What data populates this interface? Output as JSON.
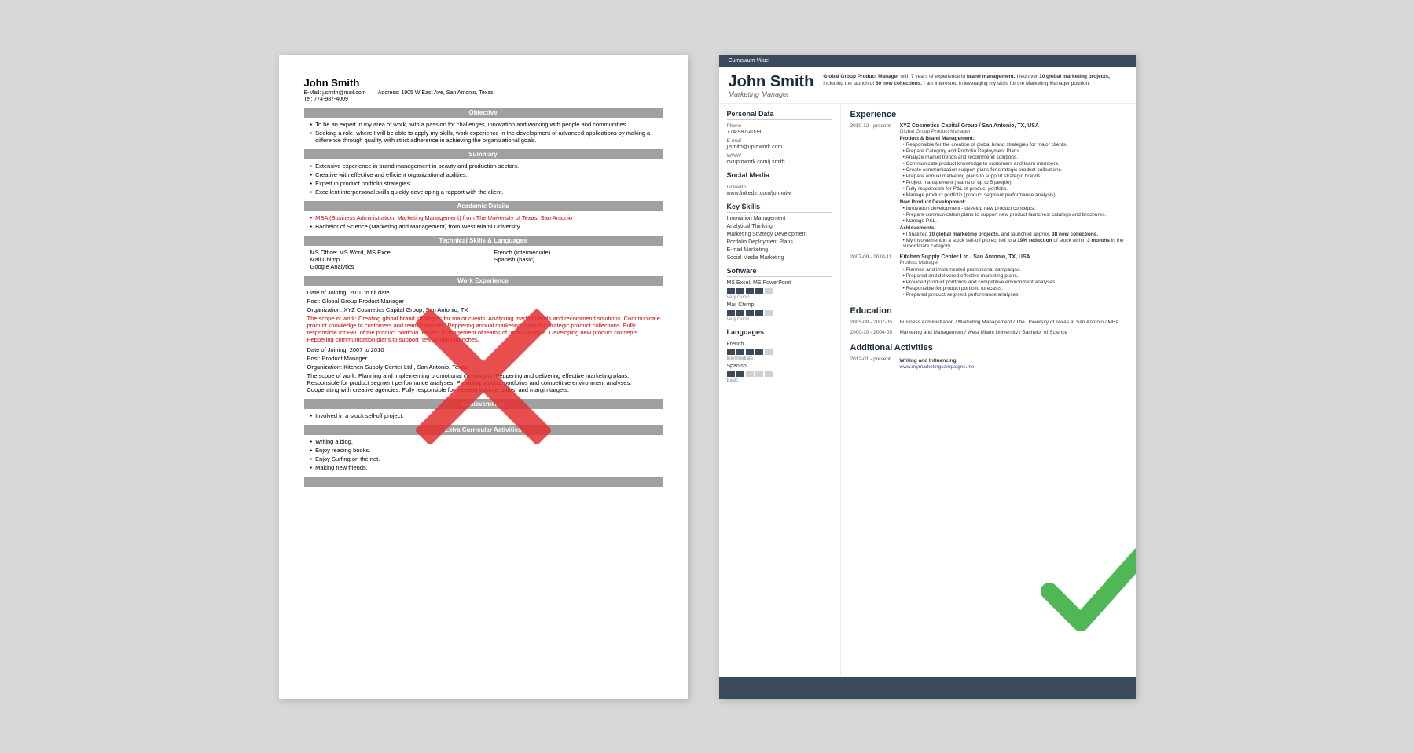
{
  "left_resume": {
    "name": "John Smith",
    "email_label": "E-Mail:",
    "email": "j.smith@mail.com",
    "address_label": "Address:",
    "address": "1905 W East Ave, San Antonio, Texas",
    "tel_label": "Tel:",
    "tel": "774-987-4009",
    "sections": {
      "objective": {
        "title": "Objective",
        "bullets": [
          "To be an expert in my area of work, with a passion for challenges, innovation and working with people and communities.",
          "Seeking a role, where I will be able to apply my skills, work experience in the development of advanced applications by making a difference through quality, with strict adherence in achieving the organizational goals."
        ]
      },
      "summary": {
        "title": "Summary",
        "bullets": [
          "Extensive experience in brand management in beauty and production sectors.",
          "Creative with effective and efficient organizational abilities.",
          "Expert in product portfolio strategies.",
          "Excellent interpersonal skills quickly developing a rapport with the client."
        ]
      },
      "academic": {
        "title": "Academic Details",
        "bullets": [
          "MBA (Business Administration, Marketing Management) from The University of Texas, San Antonio",
          "Bachelor of Science (Marketing and Management) from West Miami University"
        ]
      },
      "technical": {
        "title": "Technical Skills & Languages",
        "left_col": [
          "MS Office: MS Word, MS Excel",
          "Mail Chimp",
          "Google Analytics"
        ],
        "right_col": [
          "French (intermediate)",
          "Spanish (basic)"
        ]
      },
      "work_experience": {
        "title": "Work Experience",
        "entries": [
          {
            "date_joining": "Date of Joining: 2010 to till date",
            "post": "Post: Global Group Product Manager",
            "org": "Organization: XYZ Cosmetics Capital Group, San Antonio, TX",
            "scope": "The scope of work: Creating global brand strategies for major clients. Analyzing market trends and recommend solutions. Communicate product knowledge to customers and team members. Peppering annual marketing plans for strategic product collections. Fully responsible for P&L of the product portfolio. Project management of teams of up to 5 people. Developing new product concepts. Peppering communication plans to support new product launches."
          },
          {
            "date_joining": "Date of Joining: 2007 to 2010",
            "post": "Post: Product Manager",
            "org": "Organization: Kitchen Supply Center Ltd., San Antonio, Texas",
            "scope": "The scope of work: Planning and implementing promotional campaigns. Peppering and delivering effective marketing plans. Responsible for product segment performance analyses. Providing product portfolios and competitive environment analyses. Cooperating with creative agencies. Fully responsible for meeting volume, sales, and margin targets."
          }
        ]
      },
      "achievements": {
        "title": "Achievements",
        "bullets": [
          "Involved in a stock sell-off project."
        ]
      },
      "extra": {
        "title": "Extra Curricular Activities",
        "bullets": [
          "Writing a blog.",
          "Enjoy reading books.",
          "Enjoy Surfing on the net.",
          "Making new friends."
        ]
      }
    }
  },
  "right_resume": {
    "cv_label": "Curriculum Vitae",
    "name": "John Smith",
    "title": "Marketing Manager",
    "intro": "Global Group Product Manager with 7 years of experience in brand management. I led over 10 global marketing projects, including the launch of 60 new collections. I am interested in leveraging my skills for the Marketing Manager position.",
    "personal_data": {
      "section": "Personal Data",
      "phone_label": "Phone",
      "phone": "774-987-4009",
      "email_label": "E-mail",
      "email": "j.smith@uptowork.com",
      "www_label": "WWW",
      "www": "cv.uptowork.com/j.smith"
    },
    "social_media": {
      "section": "Social Media",
      "linkedin_label": "LinkedIn",
      "linkedin": "www.linkedin.com/johnutw"
    },
    "key_skills": {
      "section": "Key Skills",
      "items": [
        "Innovation Management",
        "Analytical Thinking",
        "Marketing Strategy Development",
        "Portfolio Deployment Plans",
        "E-mail Marketing",
        "Social Media Marketing"
      ]
    },
    "software": {
      "section": "Software",
      "items": [
        {
          "name": "MS Excel, MS PowerPoint",
          "bars": 5,
          "filled": 4,
          "level": "Very Good"
        },
        {
          "name": "Mail Chimp",
          "bars": 5,
          "filled": 4,
          "level": "Very Good"
        }
      ]
    },
    "languages": {
      "section": "Languages",
      "items": [
        {
          "name": "French",
          "bars": 5,
          "filled": 4,
          "level": "Intermediate"
        },
        {
          "name": "Spanish",
          "bars": 5,
          "filled": 2,
          "level": "Basic"
        }
      ]
    },
    "experience": {
      "section": "Experience",
      "entries": [
        {
          "dates": "2010-12 - present",
          "company": "XYZ Cosmetics Capital Group / San Antonio, TX, USA",
          "role": "Global Group Product Manager",
          "subsections": [
            {
              "title": "Product & Brand Management:",
              "bullets": [
                "Responsible for the creation of global brand strategies for major clients.",
                "Prepare Category and Portfolio Deployment Plans.",
                "Analyze market trends and recommend solutions.",
                "Communicate product knowledge to customers and team members.",
                "Create communication support plans for strategic product collections.",
                "Prepare annual marketing plans to support strategic brands.",
                "Project management (teams of up to 5 people).",
                "Fully responsible for P&L of product portfolio.",
                "Manage product portfolio (product segment performance analysis)."
              ]
            },
            {
              "title": "New Product Development:",
              "bullets": [
                "Innovation development - develop new product concepts.",
                "Prepare communication plans to support new product launches: catalogs and brochures.",
                "Manage P&L."
              ]
            },
            {
              "title": "Achievements:",
              "bullets": [
                "I finalized 10 global marketing projects, and launched approx. 38 new collections.",
                "My involvement in a stock sell-off project led to a 19% reduction of stock within 3 months in the subordinate category."
              ]
            }
          ]
        },
        {
          "dates": "2007-09 - 2010-11",
          "company": "Kitchen Supply Center Ltd / San Antonio, TX, USA",
          "role": "Product Manager",
          "bullets": [
            "Planned and implemented promotional campaigns.",
            "Prepared and delivered effective marketing plans.",
            "Provided product portfolios and competitive environment analyses.",
            "Responsible for product portfolio forecasts.",
            "Prepared product segment performance analyses."
          ]
        }
      ]
    },
    "education": {
      "section": "Education",
      "entries": [
        {
          "dates": "2005-09 - 2007-05",
          "details": "Business Administration / Marketing Management / The University of Texas at San Antonio / MBA"
        },
        {
          "dates": "2000-10 - 2004-05",
          "details": "Marketing and Management / West Miami University / Bachelor of Science"
        }
      ]
    },
    "additional": {
      "section": "Additional Activities",
      "entries": [
        {
          "dates": "2012-01 - present",
          "title": "Writing and Influencing",
          "url": "www.mymarketingcampaigns.me"
        }
      ]
    }
  }
}
